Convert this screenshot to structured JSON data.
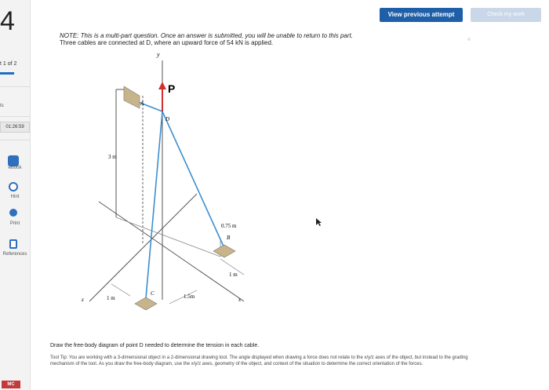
{
  "sidebar": {
    "question_number": "4",
    "part_of": "t 1 of 2",
    "points_label": "ts",
    "timer": "01:26:59",
    "items": [
      {
        "label": "eBook",
        "icon": "book-icon"
      },
      {
        "label": "Hint",
        "icon": "globe-icon"
      },
      {
        "label": "Print",
        "icon": "print-icon"
      },
      {
        "label": "References",
        "icon": "references-icon"
      }
    ],
    "logo": "MC"
  },
  "header": {
    "view_previous_label": "View previous attempt",
    "check_work_label": "Check my work"
  },
  "note": {
    "line1": "NOTE: This is a multi-part question. Once an answer is submitted, you will be unable to return to this part.",
    "line2": "Three cables are connected at D, where an upward force of 54 kN is applied."
  },
  "figure": {
    "labels": {
      "y": "y",
      "p": "P",
      "a": "A",
      "d": "D",
      "b": "B",
      "c": "C",
      "z": "z",
      "x": "x",
      "dim_3m": "3 m",
      "dim_075m": "0.75 m",
      "dim_1m_right": "1 m",
      "dim_1m_left": "1 m",
      "dim_15m": "1.5m"
    }
  },
  "instruction": "Draw the free-body diagram of point D needed to determine the tension in each cable.",
  "tooltip": "Tool Tip: You are working with a 3-dimensional object in a 2-dimensional drawing tool. The angle displayed when drawing a force does not relate to the x/y/z axes of the object, but instead to the grading mechanism of the tool. As you draw the free-body diagram, use the x/y/z axes, geometry of the object, and context of the situation to determine the correct orientation of the forces.",
  "colors": {
    "accent": "#1f5fa8",
    "cable": "#3d8fcf",
    "force_arrow": "#d0302f",
    "support": "#c8b48a"
  }
}
